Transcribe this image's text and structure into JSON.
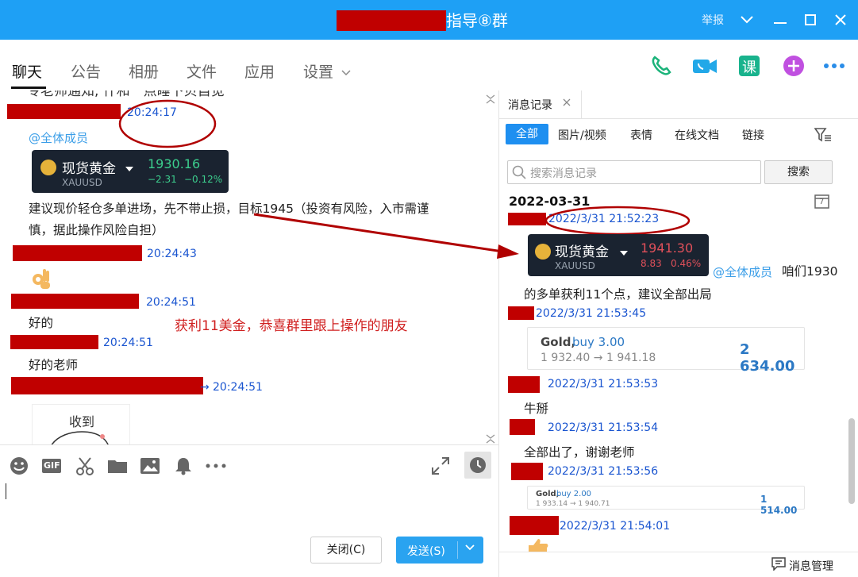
{
  "window": {
    "title": "指导⑧群",
    "report_label": "举报",
    "minimize": "—",
    "maximize": "☐",
    "close": "✕"
  },
  "tabs": [
    {
      "label": "聊天"
    },
    {
      "label": "公告"
    },
    {
      "label": "相册"
    },
    {
      "label": "文件"
    },
    {
      "label": "应用"
    },
    {
      "label": "设置"
    }
  ],
  "top_icons": [
    "phone-icon",
    "video-icon",
    "course-icon",
    "add-icon",
    "more-icon"
  ],
  "course_label": "课",
  "chat": {
    "partial_line": "专老师通知, 什和一点睡下贝自觉",
    "m1_time": "20:24:17",
    "at_all": "@全体成员",
    "quote1": {
      "name": "现货黄金",
      "code": "XAUUSD",
      "price": "1930.16",
      "change": "−2.31",
      "pct": "−0.12%"
    },
    "m1_line1": "建议现价轻仓多单进场，先不带止损，目标1945（投资有风险，入市需谨",
    "m1_line2": "慎，据此操作风险自担）",
    "m2_time": "20:24:43",
    "m3_time": "20:24:51",
    "m3_text": "好的",
    "annotation": "获利11美金，恭喜群里跟上操作的朋友",
    "m4_time": "20:24:51",
    "m4_text": "好的老师",
    "m5_time": "20:24:51",
    "m5_arrow": "→",
    "sticker_text": "收到"
  },
  "toolbar": {
    "icons": [
      "emoji-icon",
      "gif-icon",
      "scissors-icon",
      "folder-icon",
      "image-icon",
      "bell-icon",
      "more-icon"
    ],
    "gif_label": "GIF"
  },
  "buttons": {
    "close_label": "关闭(C)",
    "send_label": "发送(S)"
  },
  "history": {
    "tab_label": "消息记录",
    "filters": [
      "全部",
      "图片/视频",
      "表情",
      "在线文档",
      "链接"
    ],
    "search_placeholder": "搜索消息记录",
    "search_button": "搜索",
    "date": "2022-03-31",
    "calendar_day": "7",
    "h1_time": "2022/3/31 21:52:23",
    "quote2": {
      "name": "现货黄金",
      "code": "XAUUSD",
      "price": "1941.30",
      "change": "8.83",
      "pct": "0.46%"
    },
    "h1_at": "@全体成员",
    "h1_text_a": "咱们1930",
    "h1_text_b": "的多单获利11个点，建议全部出局",
    "h2_time": "2022/3/31 21:53:45",
    "trade1": {
      "gold": "Gold,",
      "buy": "buy 3.00",
      "prices": "1 932.40 → 1 941.18",
      "profit": "2 634.00"
    },
    "h3_time": "2022/3/31 21:53:53",
    "h3_text": "牛掰",
    "h4_time": "2022/3/31 21:53:54",
    "h4_text": "全部出了，谢谢老师",
    "h5_time": "2022/3/31 21:53:56",
    "trade2": {
      "gold": "Gold,",
      "buy": "buy 2.00",
      "prices": "1 933.14 → 1 940.71",
      "profit": "1 514.00"
    },
    "h6_time": "2022/3/31 21:54:01",
    "manage_label": "消息管理"
  },
  "colors": {
    "titlebar": "#1ea0f5",
    "redaction": "#c00000",
    "timestamp": "#1a55d0",
    "annotation": "#d02020",
    "accent": "#1e8ff0"
  }
}
